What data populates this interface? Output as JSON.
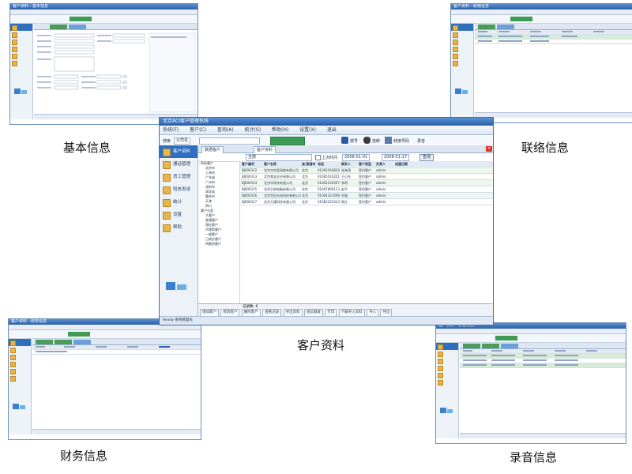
{
  "captions": {
    "basic_info": "基本信息",
    "contact_info": "联络信息",
    "customer_data": "客户资料",
    "finance_info": "财务信息",
    "recording_info": "录音信息"
  },
  "main_window": {
    "title": "北京ACI客户管理系统",
    "menu": [
      "系统(F)",
      "客户(C)",
      "查询(A)",
      "统计(S)",
      "帮助(H)",
      "设置(X)",
      "退出"
    ],
    "toolbar": {
      "search_label": "搜索",
      "scope_value": "公司名",
      "call_label": "拨号",
      "hangup_label": "挂断",
      "transfer_label": "转接号码",
      "record_label": "录音"
    },
    "sidebar": [
      "客户资料",
      "通话管理",
      "员工管理",
      "短信发送",
      "统计",
      "设置",
      "帮助"
    ],
    "tabs": [
      "数据客户",
      "客户资料"
    ],
    "filter": {
      "field_value": "全部",
      "checkbox_label": "上次时间",
      "date_from": "2008-01-01",
      "date_to": "2008-01-27",
      "query_button": "查询"
    },
    "tree": [
      "所有客户",
      "北京市",
      "上海市",
      "广东省",
      "广州市",
      "深圳市",
      "湖北省",
      "重庆市",
      "天津",
      "四川",
      "客户分类",
      "大客户",
      "普通客户",
      "潜在客户",
      "代理商客户",
      "一般客户",
      "已成交客户",
      "待跟进客户"
    ],
    "columns": [
      "客户编号",
      "客户名称",
      "省/直辖市",
      "电话",
      "联系人",
      "客户类型",
      "负责人",
      "创建日期"
    ],
    "rows": [
      [
        "BJ000312",
        "北京市信息网络有限公司",
        "北京",
        "01062456820",
        "张海涛",
        "签约客户",
        "admin",
        ""
      ],
      [
        "BJ000313",
        "北京和宝光谷有限公司",
        "北京",
        "01065543221",
        "王小东",
        "签约客户",
        "admin",
        ""
      ],
      [
        "BJ000314",
        "北京市科技有限公司",
        "北京",
        "01061234567",
        "李明",
        "签约客户",
        "admin",
        ""
      ],
      [
        "BJ000315",
        "北京天地电脑有限公司",
        "北京",
        "01067890123",
        "赵平",
        "签约客户",
        "admin",
        ""
      ],
      [
        "BJ000316",
        "北京世纪光电科技有限公司",
        "北京",
        "01064321098",
        "刘强",
        "签约客户",
        "admin",
        ""
      ],
      [
        "BJ000317",
        "北京万通科技有限公司",
        "北京",
        "01062223333",
        "陈红",
        "签约客户",
        "admin",
        ""
      ]
    ],
    "record_count": "记录数: 6",
    "bottom_buttons": [
      "增加客户",
      "修改客户",
      "删除客户",
      "查看记录",
      "导出资料",
      "短信群发",
      "打印",
      "下载导入资料",
      "导入",
      "导出"
    ],
    "status": "Ready  系统管理员"
  },
  "thumbs": {
    "basic_info": {
      "title": "客户资料 - 基本信息"
    },
    "contact_info": {
      "title": "客户资料 - 联络信息"
    },
    "finance_info": {
      "title": "客户资料 - 财务信息"
    },
    "recording_info": {
      "title": "客户资料 - 录音信息"
    }
  }
}
